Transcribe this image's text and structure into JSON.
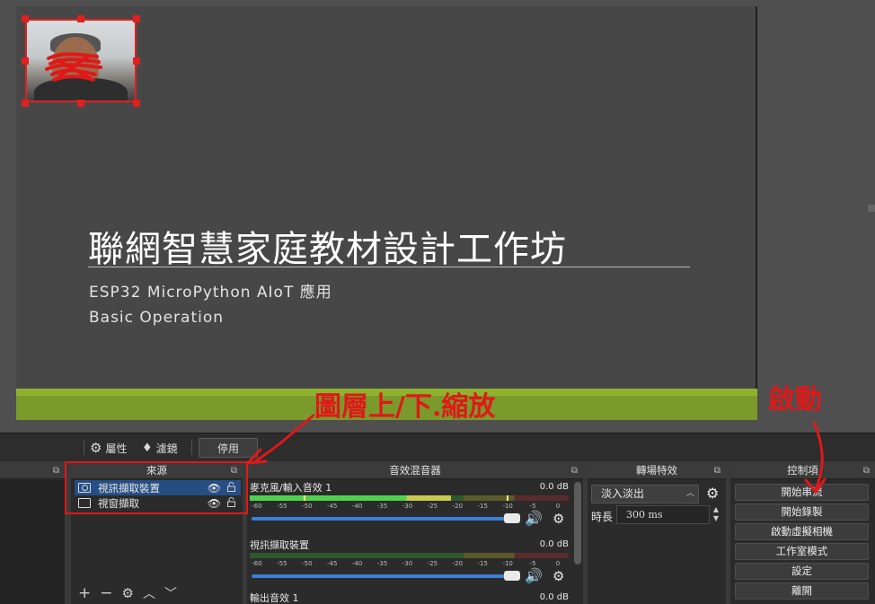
{
  "slide": {
    "title": "聯網智慧家庭教材設計工作坊",
    "subtitle": "ESP32 MicroPython AIoT 應用",
    "subtitle2": "Basic Operation"
  },
  "toolbar": {
    "properties": "屬性",
    "filters": "濾鏡",
    "disable": "停用"
  },
  "docks": {
    "sources_title": "來源",
    "mixer_title": "音效混音器",
    "transitions_title": "轉場特效",
    "controls_title": "控制項"
  },
  "sources": [
    {
      "label": "視訊擷取裝置",
      "selected": true,
      "icon": "camera-icon"
    },
    {
      "label": "視窗擷取",
      "selected": false,
      "icon": "window-icon"
    }
  ],
  "mixer": {
    "channels": [
      {
        "name": "麥克風/輸入音效 1",
        "db": "0.0 dB",
        "level": 0.63
      },
      {
        "name": "視訊擷取裝置",
        "db": "0.0 dB",
        "level": 0
      },
      {
        "name": "輸出音效 1",
        "db": "0.0 dB",
        "level": 0
      }
    ],
    "ticks": [
      "-60",
      "-55",
      "-50",
      "-45",
      "-40",
      "-35",
      "-30",
      "-25",
      "-20",
      "-15",
      "-10",
      "-5",
      "0"
    ]
  },
  "transitions": {
    "selected": "淡入淡出",
    "duration_label": "時長",
    "duration_value": "300 ms"
  },
  "controls": {
    "buttons": [
      "開始串流",
      "開始錄製",
      "啟動虛擬相機",
      "工作室模式",
      "設定",
      "離開"
    ]
  },
  "annotations": {
    "layers": "圖層上/下.縮放",
    "start": "啟動"
  },
  "colors": {
    "annotation_red": "#e01818",
    "selection_blue": "#264e84",
    "slider_blue": "#3c7fd6",
    "slide_green": "#7a9a2b"
  }
}
